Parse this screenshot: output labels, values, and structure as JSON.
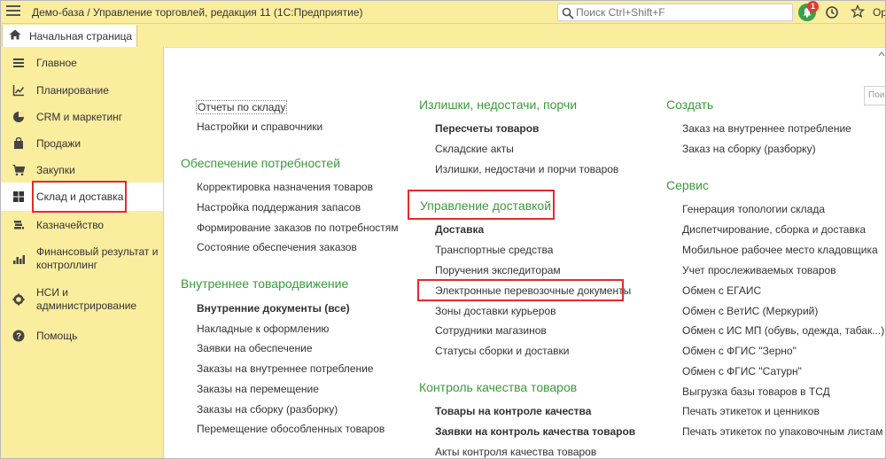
{
  "window": {
    "title": "Демо-база / Управление торговлей, редакция 11  (1С:Предприятие)",
    "search_placeholder": "Поиск Ctrl+Shift+F",
    "notification_count": "1",
    "more_text": "Ор"
  },
  "tabs": {
    "home": "Начальная страница"
  },
  "sidebar": {
    "items": [
      {
        "label": "Главное",
        "icon": "menu-lines-icon"
      },
      {
        "label": "Планирование",
        "icon": "planning-chart-icon"
      },
      {
        "label": "CRM и маркетинг",
        "icon": "pie-chart-icon"
      },
      {
        "label": "Продажи",
        "icon": "shopping-bag-icon"
      },
      {
        "label": "Закупки",
        "icon": "cart-icon"
      },
      {
        "label": "Склад и доставка",
        "icon": "warehouse-grid-icon"
      },
      {
        "label": "Казначейство",
        "icon": "coins-icon"
      },
      {
        "label": "Финансовый результат и контроллинг",
        "icon": "bar-chart-icon"
      },
      {
        "label": "НСИ и администрирование",
        "icon": "gear-icon"
      },
      {
        "label": "Помощь",
        "icon": "help-icon"
      }
    ],
    "active_index": 5
  },
  "main": {
    "search_stub": "Пои",
    "col1": {
      "top_links": [
        "Отчеты по складу",
        "Настройки и справочники"
      ],
      "sections": [
        {
          "heading": "Обеспечение потребностей",
          "links": [
            {
              "label": "Корректировка назначения товаров",
              "bold": false
            },
            {
              "label": "Настройка поддержания запасов",
              "bold": false
            },
            {
              "label": "Формирование заказов по потребностям",
              "bold": false
            },
            {
              "label": "Состояние обеспечения заказов",
              "bold": false
            }
          ]
        },
        {
          "heading": "Внутреннее товародвижение",
          "links": [
            {
              "label": "Внутренние документы (все)",
              "bold": true
            },
            {
              "label": "Накладные к оформлению",
              "bold": false
            },
            {
              "label": "Заявки на обеспечение",
              "bold": false
            },
            {
              "label": "Заказы на внутреннее потребление",
              "bold": false
            },
            {
              "label": "Заказы на перемещение",
              "bold": false
            },
            {
              "label": "Заказы на сборку (разборку)",
              "bold": false
            },
            {
              "label": "Перемещение обособленных товаров",
              "bold": false
            }
          ]
        }
      ]
    },
    "col2": {
      "sections": [
        {
          "heading": "Излишки, недостачи, порчи",
          "links": [
            {
              "label": "Пересчеты товаров",
              "bold": true
            },
            {
              "label": "Складские акты",
              "bold": false
            },
            {
              "label": "Излишки, недостачи и порчи товаров",
              "bold": false
            }
          ]
        },
        {
          "heading": "Управление доставкой",
          "links": [
            {
              "label": "Доставка",
              "bold": true
            },
            {
              "label": "Транспортные средства",
              "bold": false
            },
            {
              "label": "Поручения экспедиторам",
              "bold": false
            },
            {
              "label": "Электронные перевозочные документы",
              "bold": false
            },
            {
              "label": "Зоны доставки курьеров",
              "bold": false
            },
            {
              "label": "Сотрудники магазинов",
              "bold": false
            },
            {
              "label": "Статусы сборки и доставки",
              "bold": false
            }
          ]
        },
        {
          "heading": "Контроль качества товаров",
          "links": [
            {
              "label": "Товары на контроле качества",
              "bold": true
            },
            {
              "label": "Заявки на контроль качества товаров",
              "bold": true
            },
            {
              "label": "Акты контроля качества товаров",
              "bold": false
            }
          ]
        }
      ]
    },
    "col3": {
      "sections": [
        {
          "heading": "Создать",
          "links": [
            {
              "label": "Заказ на внутреннее потребление",
              "bold": false
            },
            {
              "label": "Заказ на сборку (разборку)",
              "bold": false
            }
          ]
        },
        {
          "heading": "Сервис",
          "links": [
            {
              "label": "Генерация топологии склада",
              "bold": false
            },
            {
              "label": "Диспетчирование, сборка и доставка",
              "bold": false
            },
            {
              "label": "Мобильное рабочее место кладовщика",
              "bold": false
            },
            {
              "label": "Учет прослеживаемых товаров",
              "bold": false
            },
            {
              "label": "Обмен с ЕГАИС",
              "bold": false
            },
            {
              "label": "Обмен с ВетИС (Меркурий)",
              "bold": false
            },
            {
              "label": "Обмен с ИС МП (обувь, одежда, табак...)",
              "bold": false
            },
            {
              "label": "Обмен с ФГИС \"Зерно\"",
              "bold": false
            },
            {
              "label": "Обмен с ФГИС \"Сатурн\"",
              "bold": false
            },
            {
              "label": "Выгрузка базы товаров в ТСД",
              "bold": false
            },
            {
              "label": "Печать этикеток и ценников",
              "bold": false
            },
            {
              "label": "Печать этикеток по упаковочным листам",
              "bold": false
            }
          ]
        }
      ]
    }
  },
  "colors": {
    "panel_bg": "#fbed9e",
    "heading_green": "#3a9a3a",
    "highlight_red": "#e32b2b"
  }
}
